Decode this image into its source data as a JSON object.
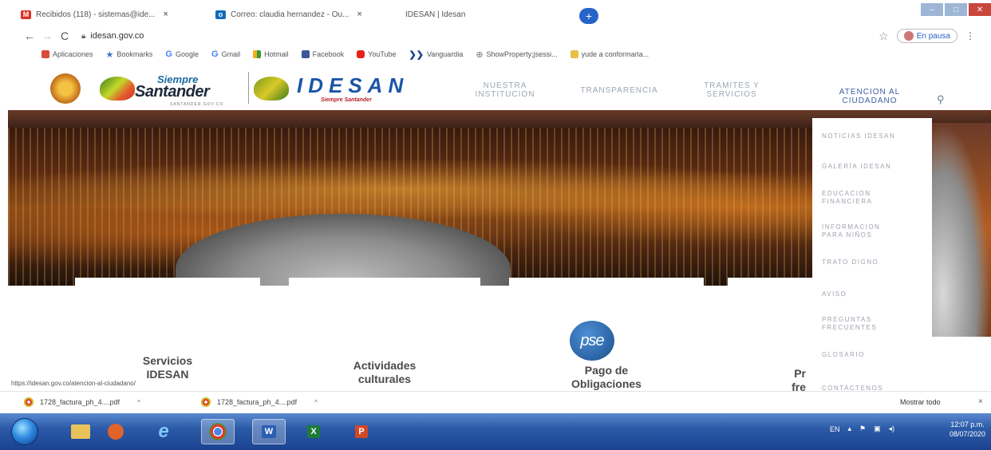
{
  "browser": {
    "tabs": [
      {
        "label": "Recibidos (118) - sistemas@ide...",
        "icon": "gmail-icon",
        "color": "#d93025"
      },
      {
        "label": "Correo: claudia hernandez - Ou...",
        "icon": "outlook-icon",
        "color": "#0f6cbd"
      },
      {
        "label": "IDESAN | Idesan",
        "icon": "idesan-favicon",
        "color": "#b7c21d"
      }
    ],
    "tab_close": "×",
    "new_tab": "+",
    "url": "idesan.gov.co",
    "profile_status": "En pausa",
    "bookmarks": [
      {
        "label": "Aplicaciones",
        "icon": "apps-icon",
        "color": "#d94c3a"
      },
      {
        "label": "Bookmarks",
        "icon": "star-icon",
        "color": "#3a72c9"
      },
      {
        "label": "Google",
        "icon": "google-icon",
        "color": "#4285f4"
      },
      {
        "label": "Gmail",
        "icon": "google-icon",
        "color": "#4285f4"
      },
      {
        "label": "Hotmail",
        "icon": "msn-icon",
        "color": "#f2b01e"
      },
      {
        "label": "Facebook",
        "icon": "facebook-icon",
        "color": "#3b5998"
      },
      {
        "label": "YouTube",
        "icon": "youtube-icon",
        "color": "#e62117"
      },
      {
        "label": "Vanguardia",
        "icon": "vanguardia-icon",
        "color": "#1a3f8c"
      },
      {
        "label": "ShowProperty;jsessi...",
        "icon": "globe-icon",
        "color": "#777777"
      },
      {
        "label": "yude a conformarla...",
        "icon": "folder-icon",
        "color": "#e6c14a"
      }
    ]
  },
  "site": {
    "brand_siempre": "Siempre",
    "brand_santander": "Santander",
    "brand_sub": "SANTANDER.GOV.CO",
    "brand_idesan": "IDESAN",
    "brand_idesan_tag": "Siempre Santander",
    "nav": [
      {
        "line1": "NUESTRA",
        "line2": "INSTITUCION"
      },
      {
        "line1": "TRANSPARENCIA",
        "line2": ""
      },
      {
        "line1": "TRAMITES Y",
        "line2": "SERVICIOS"
      },
      {
        "line1": "ATENCION AL",
        "line2": "CIUDADANO"
      }
    ],
    "dropdown": [
      {
        "line1": "NOTICIAS IDESAN",
        "line2": ""
      },
      {
        "line1": "GALERÍA IDESAN",
        "line2": ""
      },
      {
        "line1": "EDUCACION",
        "line2": "FINANCIERA"
      },
      {
        "line1": "INFORMACION",
        "line2": "PARA NIÑOS"
      },
      {
        "line1": "TRATO DIGNO",
        "line2": ""
      },
      {
        "line1": "AVISO",
        "line2": ""
      },
      {
        "line1": "PREGUNTAS",
        "line2": "FRECUENTES"
      },
      {
        "line1": "GLOSARIO",
        "line2": ""
      },
      {
        "line1": "CONTACTENOS",
        "line2": ""
      }
    ],
    "cards": [
      {
        "line1": "Servicios",
        "line2": "IDESAN"
      },
      {
        "line1": "Actividades",
        "line2": "culturales"
      },
      {
        "line1": "Pago de",
        "line2": "Obligaciones"
      },
      {
        "line1": "Pr",
        "line2": "fre"
      }
    ],
    "pse_logo": "pse",
    "status_url": "https://idesan.gov.co/atencion-al-ciudadano/"
  },
  "downloads": {
    "items": [
      "1728_factura_ph_4....pdf",
      "1728_factura_ph_4....pdf"
    ],
    "show_all": "Mostrar todo",
    "close": "×"
  },
  "taskbar": {
    "apps": [
      {
        "label": "",
        "icon": "explorer-folder-icon",
        "color": "#e8c35a"
      },
      {
        "label": "",
        "icon": "media-player-icon",
        "color": "#e0632a"
      },
      {
        "label": "e",
        "icon": "internet-explorer-icon",
        "color": "#3da0e6"
      },
      {
        "label": "",
        "icon": "chrome-icon",
        "color": "#3a9a3a"
      },
      {
        "label": "W",
        "icon": "word-icon",
        "color": "#2b5fb4"
      },
      {
        "label": "X",
        "icon": "excel-icon",
        "color": "#1f7a3a"
      },
      {
        "label": "P",
        "icon": "powerpoint-icon",
        "color": "#d24726"
      }
    ],
    "language": "EN",
    "time": "12:07 p.m.",
    "date": "08/07/2020"
  },
  "colors": {
    "taskbar_blue": "#2c5ba8",
    "idesan_blue": "#1b55a8",
    "santander_red": "#b5212c"
  }
}
